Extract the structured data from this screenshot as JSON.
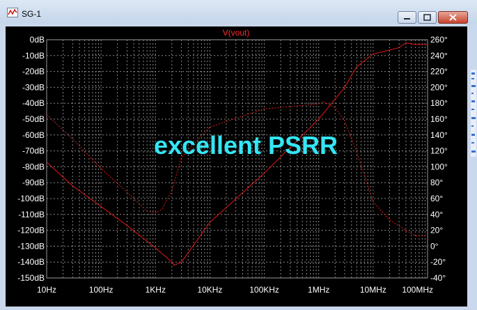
{
  "window": {
    "title": "SG-1"
  },
  "chart_data": {
    "type": "line",
    "title": "V(vout)",
    "annotation": "excellent PSRR",
    "xscale": "log",
    "x_ticks": [
      10,
      100,
      1000,
      10000,
      100000,
      1000000,
      10000000,
      100000000
    ],
    "x_tick_labels": [
      "10Hz",
      "100Hz",
      "1KHz",
      "10KHz",
      "100KHz",
      "1MHz",
      "10MHz",
      "100MHz"
    ],
    "ylim": [
      -150,
      0
    ],
    "y_tick_labels": [
      "0dB",
      "-10dB",
      "-20dB",
      "-30dB",
      "-40dB",
      "-50dB",
      "-60dB",
      "-70dB",
      "-80dB",
      "-90dB",
      "-100dB",
      "-110dB",
      "-120dB",
      "-130dB",
      "-140dB",
      "-150dB"
    ],
    "y2lim": [
      -40,
      260
    ],
    "y2_tick_labels": [
      "260°",
      "240°",
      "220°",
      "200°",
      "180°",
      "160°",
      "140°",
      "120°",
      "100°",
      "80°",
      "60°",
      "40°",
      "20°",
      "0°",
      "-20°",
      "-40°"
    ],
    "grid": true,
    "series": [
      {
        "axis": "magnitude",
        "style": "solid",
        "color": "#d01818",
        "x": [
          10,
          30,
          100,
          300,
          1000,
          2000,
          2200,
          3000,
          10000,
          100000,
          1000000,
          3000000,
          5000000,
          10000000,
          30000000,
          40000000,
          60000000,
          100000000
        ],
        "y": [
          -77,
          -92,
          -105,
          -117,
          -131,
          -140,
          -142,
          -140,
          -115,
          -84,
          -50,
          -30,
          -17,
          -9,
          -5,
          -2,
          -3,
          -3
        ]
      },
      {
        "axis": "phase",
        "style": "dashed",
        "color": "#d01818",
        "x": [
          10,
          30,
          100,
          300,
          700,
          1000,
          1300,
          2000,
          3000,
          10000,
          100000,
          1000000,
          1200000,
          2000000,
          3000000,
          5000000,
          10000000,
          20000000,
          40000000,
          60000000,
          100000000
        ],
        "y": [
          166,
          135,
          98,
          68,
          44,
          42,
          46,
          70,
          112,
          150,
          173,
          179,
          182,
          174,
          158,
          118,
          56,
          33,
          20,
          13,
          13
        ]
      }
    ]
  }
}
